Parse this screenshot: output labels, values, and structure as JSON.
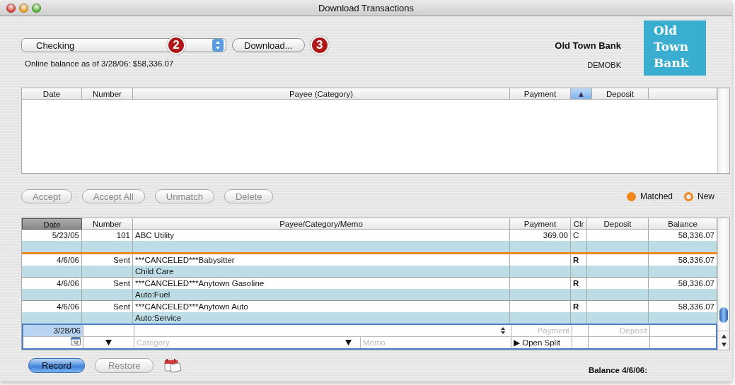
{
  "window": {
    "title": "Download Transactions"
  },
  "account_popup": {
    "value": "Checking",
    "callout": "2"
  },
  "download_button": {
    "label": "Download...",
    "callout": "3"
  },
  "online_balance": "Online balance as of 3/28/06: $58,336.07",
  "bank": {
    "name": "Old Town Bank",
    "id": "DEMOBK",
    "logo_lines": [
      "Old",
      "Town",
      "Bank"
    ]
  },
  "downloaded_table": {
    "columns": [
      {
        "label": "Date",
        "selected": false
      },
      {
        "label": "Number",
        "selected": false
      },
      {
        "label": "Payee (Category)",
        "selected": false
      },
      {
        "label": "Payment",
        "selected": false
      },
      {
        "label": "▲",
        "selected": true
      },
      {
        "label": "Deposit",
        "selected": false
      },
      {
        "selected": false
      }
    ]
  },
  "action_buttons": [
    {
      "label": "Accept",
      "disabled": true
    },
    {
      "label": "Accept All",
      "disabled": true
    },
    {
      "label": "Unmatch",
      "disabled": true
    },
    {
      "label": "Delete",
      "disabled": true
    }
  ],
  "legend": [
    {
      "label": "Matched",
      "kind": "filled",
      "color": "#f0871a"
    },
    {
      "label": "New",
      "kind": "ring",
      "color": "#f0871a"
    }
  ],
  "register": {
    "columns": [
      {
        "label": "Date",
        "selected": true
      },
      {
        "label": "Number",
        "selected": false
      },
      {
        "label": "Payee/Category/Memo",
        "selected": false
      },
      {
        "label": "Payment",
        "selected": false
      },
      {
        "label": "Clr",
        "selected": false
      },
      {
        "label": "Deposit",
        "selected": false
      },
      {
        "label": "Balance",
        "selected": false
      }
    ],
    "rows": [
      {
        "date": "5/23/05",
        "number": "101",
        "payee": "ABC Utility",
        "payment": "369.00",
        "clr": "C",
        "clr_bold": false,
        "balance": "58,336.07",
        "matched_divider": true
      },
      {
        "date": "4/6/06",
        "number": "Sent",
        "payee": "***CANCELED***Babysitter",
        "category": "Child Care",
        "clr": "R",
        "clr_bold": true,
        "balance": "58,336.07",
        "matched_divider": false
      },
      {
        "date": "4/6/06",
        "number": "Sent",
        "payee": "***CANCELED***Anytown Gasoline",
        "category": "Auto:Fuel",
        "clr": "R",
        "clr_bold": true,
        "balance": "58,336.07",
        "matched_divider": false
      },
      {
        "date": "4/6/06",
        "number": "Sent",
        "payee": "***CANCELED***Anytown Auto",
        "category": "Auto:Service",
        "clr": "R",
        "clr_bold": true,
        "balance": "58,336.07",
        "matched_divider": false
      }
    ],
    "entry": {
      "date": "3/28/06",
      "payment_placeholder": "Payment",
      "deposit_placeholder": "Deposit",
      "category_placeholder": "Category",
      "memo_placeholder": "Memo",
      "split_button": "▶ Open Split"
    }
  },
  "footer_buttons": [
    {
      "label": "Record",
      "default": true,
      "disabled": false
    },
    {
      "label": "Restore",
      "default": false,
      "disabled": true
    }
  ],
  "balance_label": "Balance 4/6/06:"
}
